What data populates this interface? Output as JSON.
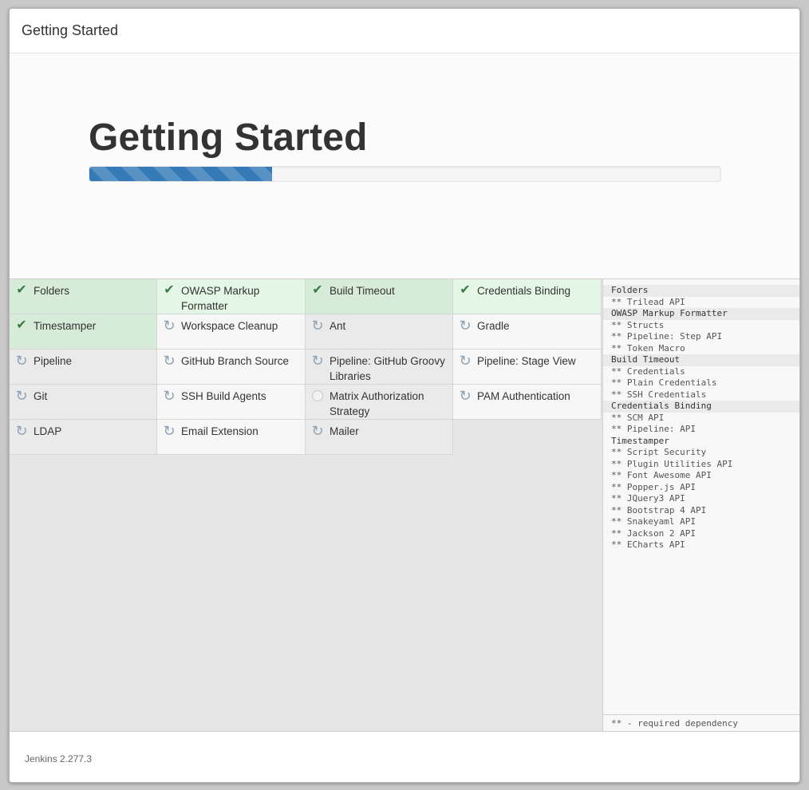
{
  "window": {
    "title": "Getting Started"
  },
  "hero": {
    "title": "Getting Started",
    "progress": 0.29
  },
  "plugins": [
    {
      "label": "Folders",
      "status": "success",
      "icon": "check-icon"
    },
    {
      "label": "OWASP Markup Formatter",
      "status": "success",
      "icon": "check-icon"
    },
    {
      "label": "Build Timeout",
      "status": "success",
      "icon": "check-icon"
    },
    {
      "label": "Credentials Binding",
      "status": "success",
      "icon": "check-icon"
    },
    {
      "label": "Timestamper",
      "status": "success",
      "icon": "check-icon"
    },
    {
      "label": "Workspace Cleanup",
      "status": "installing",
      "icon": "refresh-icon"
    },
    {
      "label": "Ant",
      "status": "installing",
      "icon": "refresh-icon"
    },
    {
      "label": "Gradle",
      "status": "installing",
      "icon": "refresh-icon"
    },
    {
      "label": "Pipeline",
      "status": "installing",
      "icon": "refresh-icon"
    },
    {
      "label": "GitHub Branch Source",
      "status": "installing",
      "icon": "refresh-icon"
    },
    {
      "label": "Pipeline: GitHub Groovy Libraries",
      "status": "installing",
      "icon": "refresh-icon"
    },
    {
      "label": "Pipeline: Stage View",
      "status": "installing",
      "icon": "refresh-icon"
    },
    {
      "label": "Git",
      "status": "installing",
      "icon": "refresh-icon"
    },
    {
      "label": "SSH Build Agents",
      "status": "installing",
      "icon": "refresh-icon"
    },
    {
      "label": "Matrix Authorization Strategy",
      "status": "pending",
      "icon": "pending-circle-icon"
    },
    {
      "label": "PAM Authentication",
      "status": "installing",
      "icon": "refresh-icon"
    },
    {
      "label": "LDAP",
      "status": "installing",
      "icon": "refresh-icon"
    },
    {
      "label": "Email Extension",
      "status": "installing",
      "icon": "refresh-icon"
    },
    {
      "label": "Mailer",
      "status": "installing",
      "icon": "refresh-icon"
    }
  ],
  "dependencies": [
    {
      "text": "Folders",
      "parent": true,
      "shaded": true
    },
    {
      "text": "** Trilead API",
      "parent": false
    },
    {
      "text": "OWASP Markup Formatter",
      "parent": true,
      "shaded": true
    },
    {
      "text": "** Structs",
      "parent": false
    },
    {
      "text": "** Pipeline: Step API",
      "parent": false
    },
    {
      "text": "** Token Macro",
      "parent": false
    },
    {
      "text": "Build Timeout",
      "parent": true,
      "shaded": true
    },
    {
      "text": "** Credentials",
      "parent": false
    },
    {
      "text": "** Plain Credentials",
      "parent": false
    },
    {
      "text": "** SSH Credentials",
      "parent": false
    },
    {
      "text": "Credentials Binding",
      "parent": true,
      "shaded": true
    },
    {
      "text": "** SCM API",
      "parent": false
    },
    {
      "text": "** Pipeline: API",
      "parent": false
    },
    {
      "text": "Timestamper",
      "parent": true,
      "shaded": false
    },
    {
      "text": "** Script Security",
      "parent": false
    },
    {
      "text": "** Plugin Utilities API",
      "parent": false
    },
    {
      "text": "** Font Awesome API",
      "parent": false
    },
    {
      "text": "** Popper.js API",
      "parent": false
    },
    {
      "text": "** JQuery3 API",
      "parent": false
    },
    {
      "text": "** Bootstrap 4 API",
      "parent": false
    },
    {
      "text": "** Snakeyaml API",
      "parent": false
    },
    {
      "text": "** Jackson 2 API",
      "parent": false
    },
    {
      "text": "** ECharts API",
      "parent": false
    }
  ],
  "legend": "** - required dependency",
  "footer": {
    "version": "Jenkins 2.277.3"
  }
}
